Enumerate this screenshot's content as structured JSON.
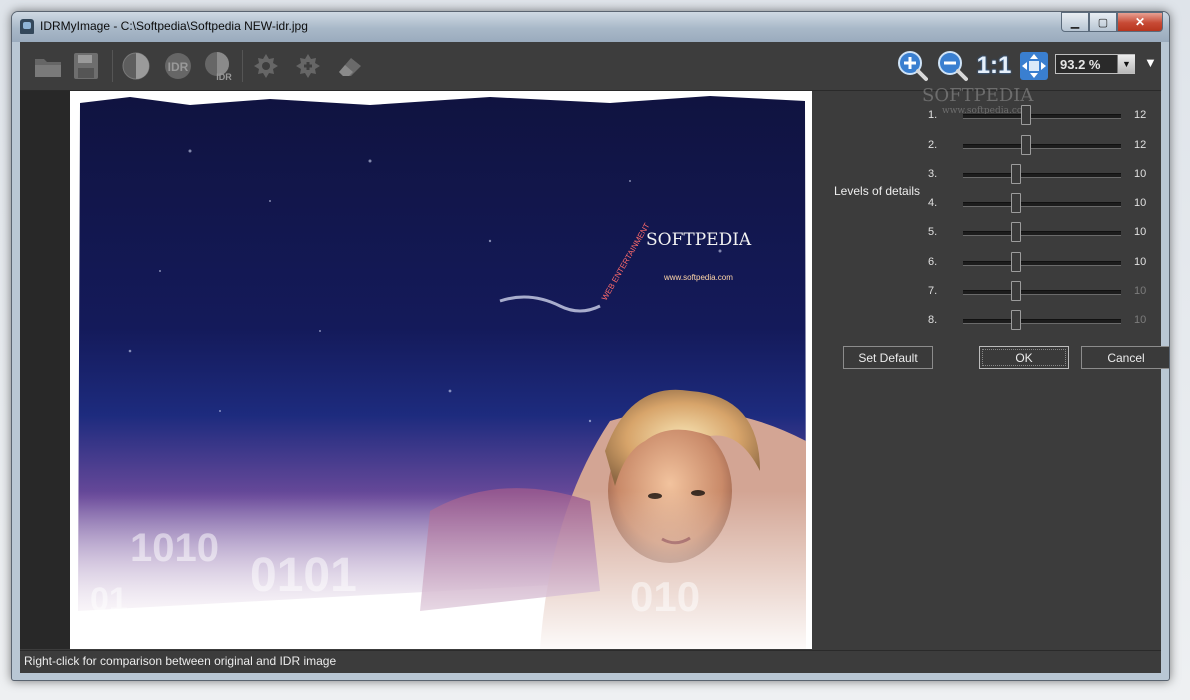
{
  "window": {
    "title": "IDRMyImage - C:\\Softpedia\\Softpedia NEW-idr.jpg"
  },
  "toolbar": {
    "icons": [
      "open-folder-icon",
      "save-icon",
      "compare-icon",
      "idr-icon",
      "idr-split-icon",
      "settings-icon",
      "effects-icon",
      "eraser-icon",
      "zoom-in-icon",
      "zoom-out-icon",
      "actual-size-icon",
      "fit-window-icon"
    ],
    "actual_size_label": "1:1",
    "zoom_value": "93.2 %"
  },
  "image": {
    "brand": "SOFTPEDIA",
    "url": "www.softpedia.com",
    "tagline": "WEB ENTERTAINMENT"
  },
  "panel": {
    "watermark_brand": "SOFTPEDIA",
    "watermark_url": "www.softpedia.com",
    "levels_label": "Levels of details",
    "sliders": [
      {
        "num": "1.",
        "value": "12",
        "level": 12,
        "enabled": true
      },
      {
        "num": "2.",
        "value": "12",
        "level": 12,
        "enabled": true
      },
      {
        "num": "3.",
        "value": "10",
        "level": 10,
        "enabled": true
      },
      {
        "num": "4.",
        "value": "10",
        "level": 10,
        "enabled": true
      },
      {
        "num": "5.",
        "value": "10",
        "level": 10,
        "enabled": true
      },
      {
        "num": "6.",
        "value": "10",
        "level": 10,
        "enabled": true
      },
      {
        "num": "7.",
        "value": "10",
        "level": 10,
        "enabled": false
      },
      {
        "num": "8.",
        "value": "10",
        "level": 10,
        "enabled": false
      }
    ],
    "buttons": {
      "set_default": "Set Default",
      "ok": "OK",
      "cancel": "Cancel"
    }
  },
  "status": {
    "text": "Right-click for comparison between original and IDR image"
  }
}
